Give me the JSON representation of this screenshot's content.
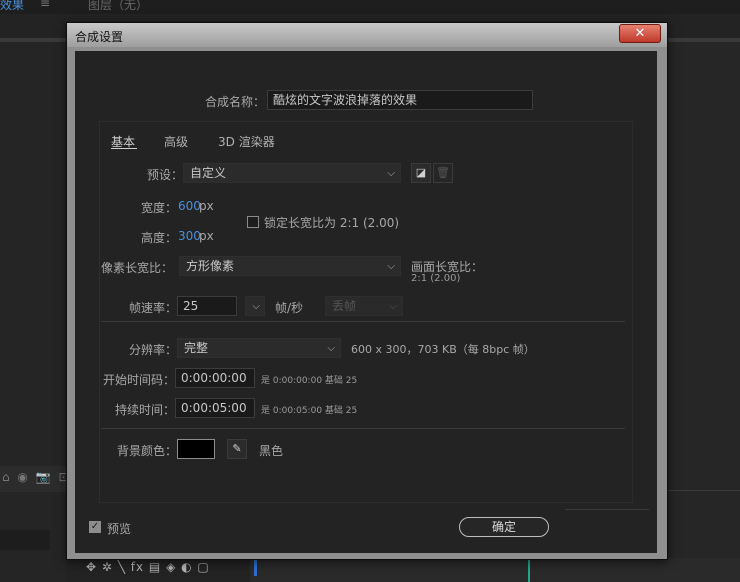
{
  "background": {
    "tab1": "效果",
    "tab1_menu": "≡",
    "tab2": "图层（无）",
    "left_icons": "⌂ ◉ 📷 ⊡",
    "bottom_tools": "✥ ✲ ╲ fx ▤ ◈ ◐ ▢"
  },
  "dialog": {
    "title": "合成设置",
    "close": "✕",
    "name_label": "合成名称：",
    "name_value": "酷炫的文字波浪掉落的效果",
    "tabs": [
      "基本",
      "高级",
      "3D 渲染器"
    ],
    "preset": {
      "label": "预设：",
      "value": "自定义"
    },
    "width": {
      "label": "宽度：",
      "value": "600",
      "unit": "px"
    },
    "height": {
      "label": "高度：",
      "value": "300",
      "unit": "px"
    },
    "lock_ratio": {
      "label": "锁定长宽比为 2:1 (2.00)",
      "checked": false
    },
    "pixel_aspect": {
      "label": "像素长宽比：",
      "value": "方形像素"
    },
    "frame_aspect": {
      "label": "画面长宽比：",
      "value": "2:1 (2.00)"
    },
    "frame_rate": {
      "label": "帧速率：",
      "value": "25",
      "unit": "帧/秒",
      "drop_frame": "丢帧"
    },
    "resolution": {
      "label": "分辨率：",
      "value": "完整",
      "info": "600 x 300，703 KB（每 8bpc 帧）"
    },
    "start_tc": {
      "label": "开始时间码：",
      "value": "0:00:00:00",
      "info": "是 0:00:00:00  基础 25"
    },
    "duration": {
      "label": "持续时间：",
      "value": "0:00:05:00",
      "info": "是 0:00:05:00  基础 25"
    },
    "bg_color": {
      "label": "背景颜色：",
      "color": "#000000",
      "name": "黑色"
    },
    "preview": {
      "label": "预览",
      "checked": true
    },
    "ok": "确定"
  },
  "colors": {
    "accent": "#4a90d9",
    "dialog_bg": "#232323"
  }
}
